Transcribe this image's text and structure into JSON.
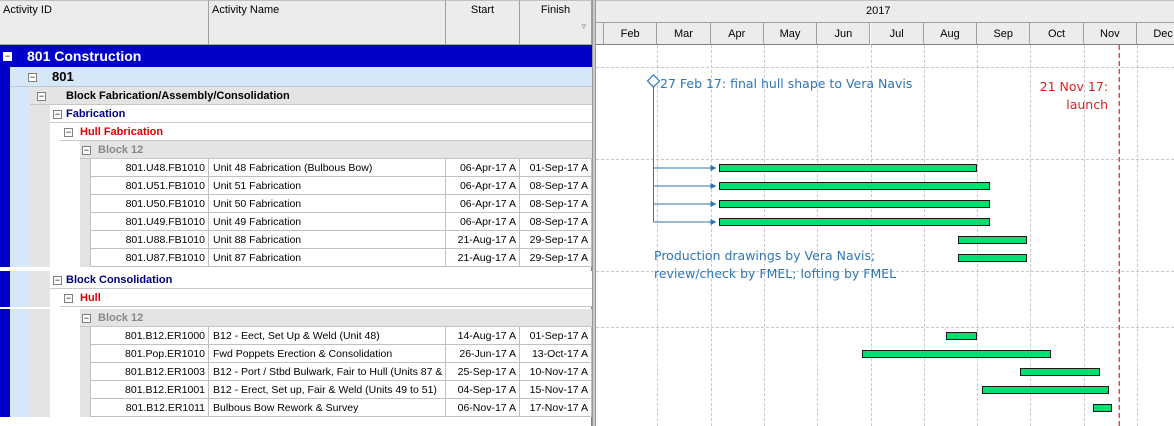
{
  "columns": {
    "activity_id": "Activity ID",
    "activity_name": "Activity Name",
    "start": "Start",
    "finish": "Finish"
  },
  "groups": {
    "project": "801 Construction",
    "wbs": "801",
    "block_fab": "Block Fabrication/Assembly/Consolidation",
    "fabrication": "Fabrication",
    "hull_fabrication": "Hull  Fabrication",
    "block12_a": "Block 12",
    "block_consolidation": "Block Consolidation",
    "hull": "Hull",
    "block12_b": "Block 12"
  },
  "activities": [
    {
      "id": "801.U48.FB1010",
      "name": "Unit 48 Fabrication (Bulbous Bow)",
      "start": "06-Apr-17 A",
      "finish": "01-Sep-17 A"
    },
    {
      "id": "801.U51.FB1010",
      "name": "Unit 51 Fabrication",
      "start": "06-Apr-17 A",
      "finish": "08-Sep-17 A"
    },
    {
      "id": "801.U50.FB1010",
      "name": "Unit 50 Fabrication",
      "start": "06-Apr-17 A",
      "finish": "08-Sep-17 A"
    },
    {
      "id": "801.U49.FB1010",
      "name": "Unit 49 Fabrication",
      "start": "06-Apr-17 A",
      "finish": "08-Sep-17 A"
    },
    {
      "id": "801.U88.FB1010",
      "name": "Unit 88 Fabrication",
      "start": "21-Aug-17 A",
      "finish": "29-Sep-17 A"
    },
    {
      "id": "801.U87.FB1010",
      "name": "Unit 87 Fabrication",
      "start": "21-Aug-17 A",
      "finish": "29-Sep-17 A"
    },
    {
      "id": "801.B12.ER1000",
      "name": "B12 - Eect, Set Up & Weld (Unit 48)",
      "start": "14-Aug-17 A",
      "finish": "01-Sep-17 A"
    },
    {
      "id": "801.Pop.ER1010",
      "name": "Fwd Poppets Erection & Consolidation",
      "start": "26-Jun-17 A",
      "finish": "13-Oct-17 A"
    },
    {
      "id": "801.B12.ER1003",
      "name": "B12 - Port / Stbd Bulwark, Fair to Hull (Units 87 & 88)",
      "start": "25-Sep-17 A",
      "finish": "10-Nov-17 A"
    },
    {
      "id": "801.B12.ER1001",
      "name": "B12 - Erect, Set up, Fair & Weld  (Units 49 to 51)",
      "start": "04-Sep-17 A",
      "finish": "15-Nov-17 A"
    },
    {
      "id": "801.B12.ER1011",
      "name": "Bulbous Bow Rework & Survey",
      "start": "06-Nov-17 A",
      "finish": "17-Nov-17 A"
    }
  ],
  "timeline": {
    "year": "2017",
    "months": [
      "Feb",
      "Mar",
      "Apr",
      "May",
      "Jun",
      "Jul",
      "Aug",
      "Sep",
      "Oct",
      "Nov",
      "Dec"
    ],
    "milestone_date": "27-Feb-17",
    "launch_date": "21-Nov-17",
    "dependency_arrows": 4
  },
  "annotations": {
    "milestone_note": "27 Feb 17:  final hull shape to Vera Navis",
    "launch_line1": "21 Nov 17:",
    "launch_line2": "launch",
    "drawings_line1": "Production drawings by Vera Navis;",
    "drawings_line2": "review/check by FMEL; lofting by FMEL"
  },
  "colors": {
    "project_band": "#0000c8",
    "wbs_band": "#d6e8f8",
    "bar_fill": "#00e070",
    "hull_group_text": "#e00000",
    "group_text_blue": "#000080",
    "annotation_blue": "#2e75b6",
    "launch_red": "#e02020"
  }
}
